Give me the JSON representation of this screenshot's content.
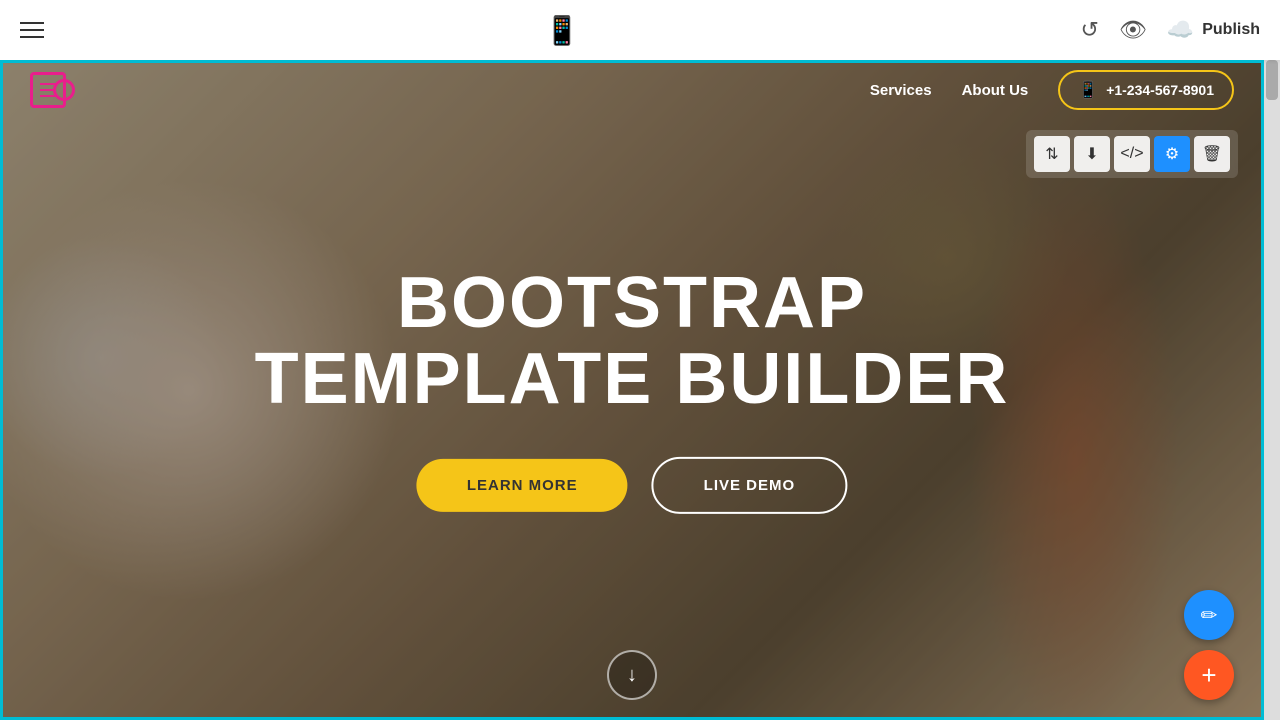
{
  "toolbar": {
    "menu_label": "Menu",
    "preview_device": "mobile",
    "undo_label": "Undo",
    "view_label": "Preview",
    "publish_label": "Publish"
  },
  "nav": {
    "logo_alt": "Logo",
    "links": [
      {
        "label": "Services",
        "href": "#"
      },
      {
        "label": "About Us",
        "href": "#"
      }
    ],
    "phone": "+1-234-567-8901"
  },
  "hero": {
    "title_line1": "BOOTSTRAP",
    "title_line2": "TEMPLATE BUILDER",
    "btn_learn": "LEARN MORE",
    "btn_demo": "LIVE DEMO",
    "arrow_label": "↓"
  },
  "section_tools": {
    "move": "⇅",
    "download": "⬇",
    "code": "</>",
    "settings": "⚙",
    "delete": "🗑"
  },
  "fabs": {
    "edit_icon": "✏",
    "add_icon": "+"
  }
}
